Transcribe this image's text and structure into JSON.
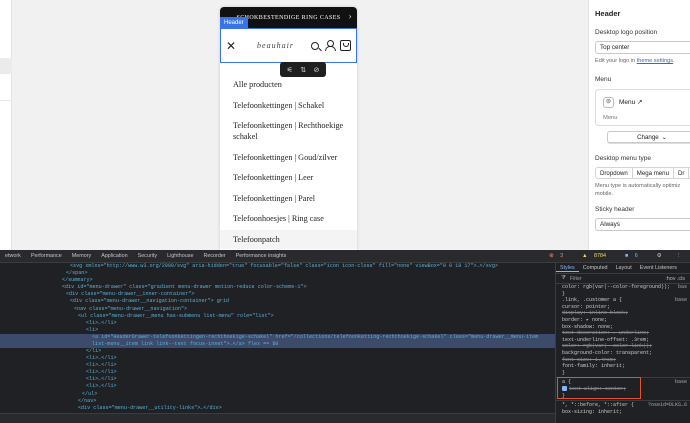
{
  "preview": {
    "announcement": "SCHOKBESTENDIGE RING CASES",
    "header_tag": "Header",
    "logo_text": "beauhair",
    "menu_items": [
      "Alle producten",
      "Telefoonkettingen | Schakel",
      "Telefoonkettingen | Rechthoekige schakel",
      "Telefoonkettingen | Goud/zilver",
      "Telefoonkettingen | Leer",
      "Telefoonkettingen | Parel",
      "Telefoonhoesjes | Ring case",
      "Telefoonpatch"
    ]
  },
  "panel": {
    "title": "Header",
    "logo_position_label": "Desktop logo position",
    "logo_position_value": "Top center",
    "logo_help_prefix": "Edit your logo in",
    "logo_help_link": "theme settings",
    "menu_label": "Menu",
    "menu_name": "Menu",
    "menu_sub": "Menu",
    "change_button": "Change",
    "menu_type_label": "Desktop menu type",
    "menu_type_options": [
      "Dropdown",
      "Mega menu",
      "Dr"
    ],
    "menu_type_help": "Menu type is automatically optimiz mobile.",
    "sticky_label": "Sticky header",
    "sticky_value": "Always"
  },
  "devtools": {
    "tabs": [
      "etwork",
      "Performance",
      "Memory",
      "Application",
      "Security",
      "Lighthouse",
      "Recorder",
      "Performance insights"
    ],
    "badges": {
      "errors": "3",
      "warnings": "8784",
      "info": "6"
    },
    "elements_lines": [
      "<svg xmlns=\"http://www.w3.org/2000/svg\" aria-hidden=\"true\" focusable=\"false\" class=\"icon icon-close\" fill=\"none\" viewBox=\"0 0 18 17\">…</svg>",
      "</span>",
      "</summary>",
      "<div id=\"menu-drawer\" class=\"gradient menu-drawer motion-reduce color-scheme-1\">",
      "<div class=\"menu-drawer__inner-container\">",
      "<div class=\"menu-drawer__navigation-container\"> grid",
      "<nav class=\"menu-drawer__navigation\">",
      "<ul class=\"menu-drawer__menu has-submenu list-menu\" role=\"list\">",
      "<li>…</li>",
      "<li>",
      "<a id=\"HeaderDrawer-telefoonkettingen-rechthoekige-schakel\" href=\"/collections/telefoonketting-rechthoekige-schakel\" class=\"menu-drawer__menu-item list-menu__item link link--text focus-inset\">…</a> flex == $0",
      "</li>",
      "<li>…</li>",
      "<li>…</li>",
      "<li>…</li>",
      "<li>…</li>",
      "<li>…</li>",
      "</ul>",
      "</nav>",
      "<div class=\"menu-drawer__utility-links\">…</div>"
    ],
    "breadcrumbs": "",
    "styles_tabs": [
      "Styles",
      "Computed",
      "Layout",
      "Event Listeners"
    ],
    "filter_placeholder": "Filter",
    "filter_hov": ":hov .cls",
    "rules": [
      {
        "text": "color: rgb(var(--color-foreground));",
        "strike": false
      },
      {
        "text": "}",
        "strike": false
      },
      {
        "text": ".link, .customer a {",
        "strike": false
      },
      {
        "text": "cursor: pointer;",
        "strike": false
      },
      {
        "text": "display: inline-block;",
        "strike": true
      },
      {
        "text": "border: ▸ none;",
        "strike": false
      },
      {
        "text": "box-shadow: none;",
        "strike": false
      },
      {
        "text": "text-decoration: ▸ underline;",
        "strike": true
      },
      {
        "text": "text-underline-offset: .3rem;",
        "strike": false
      },
      {
        "text": "color: rgb(var(--color-link));",
        "strike": true
      },
      {
        "text": "background-color: transparent;",
        "strike": false
      },
      {
        "text": "font-size: 1.4rem;",
        "strike": true
      },
      {
        "text": "font-family: inherit;",
        "strike": false
      },
      {
        "text": "}",
        "strike": false
      }
    ],
    "rule_a_selector": "a {",
    "rule_a_prop": "text-align: center;",
    "rule_a_close": "}",
    "rule_a_src": "base",
    "rule_star": "*, *::before, *::after {",
    "rule_star_prop": "box-sizing: inherit;",
    "rule_star_src": "?oseid=DLKS…6",
    "rule_link_src": "base",
    "rule_top_src": "bas"
  }
}
